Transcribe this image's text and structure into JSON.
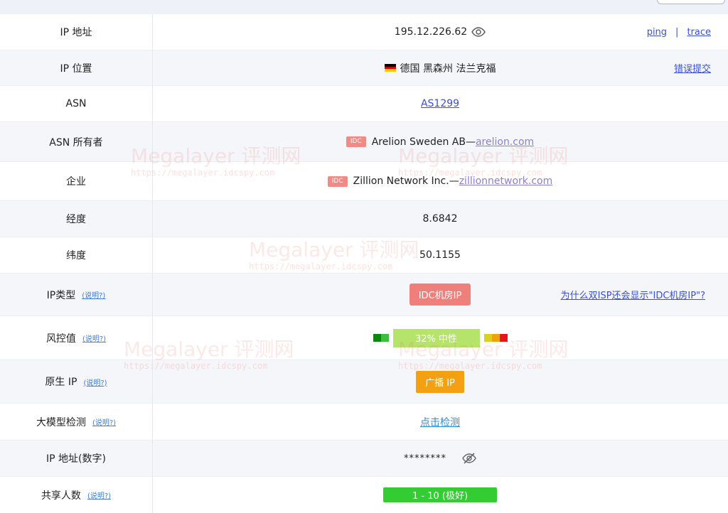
{
  "rows": {
    "ip": {
      "label": "IP 地址",
      "value": "195.12.226.62",
      "ping": "ping",
      "sep": "|",
      "trace": "trace"
    },
    "location": {
      "label": "IP 位置",
      "value": "德国 黑森州 法兰克福",
      "report": "错误提交"
    },
    "asn": {
      "label": "ASN",
      "value": "AS1299"
    },
    "asn_owner": {
      "label": "ASN 所有者",
      "tag": "IDC",
      "name": "Arelion Sweden AB— ",
      "domain": "arelion.com"
    },
    "company": {
      "label": "企业",
      "tag": "IDC",
      "name": "Zillion Network Inc.— ",
      "domain": "zillionnetwork.com"
    },
    "longitude": {
      "label": "经度",
      "value": "8.6842"
    },
    "latitude": {
      "label": "纬度",
      "value": "50.1155"
    },
    "ip_type": {
      "label": "IP类型",
      "help": "(说明?)",
      "badge": "IDC机房IP",
      "why": "为什么双ISP还会显示\"IDC机房IP\"?"
    },
    "risk": {
      "label": "风控值",
      "help": "(说明?)",
      "value": "32%  中性",
      "level": 0.32
    },
    "native": {
      "label": "原生 IP",
      "help": "(说明?)",
      "badge": "广播 IP"
    },
    "llm": {
      "label": "大模型检测",
      "help": "(说明?)",
      "link": "点击检测"
    },
    "ip_numeric": {
      "label": "IP 地址(数字)",
      "value": "********"
    },
    "shared": {
      "label": "共享人数",
      "help": "(说明?)",
      "value": "1 - 10 (极好)"
    }
  },
  "watermark": {
    "title": "Megalayer 评测网",
    "url": "https://megalayer.idcspy.com"
  },
  "icons": {
    "eye": "eye-icon",
    "eye_off": "eye-slash-icon",
    "flag": "germany-flag-icon"
  },
  "colors": {
    "link": "#3a4fd8",
    "idc_tag": "#ef8a84",
    "idc_badge": "#ef7f7a",
    "risk_pill": "#b6e36a",
    "broadcast_badge": "#f4a013",
    "shared_badge": "#33cc33"
  }
}
